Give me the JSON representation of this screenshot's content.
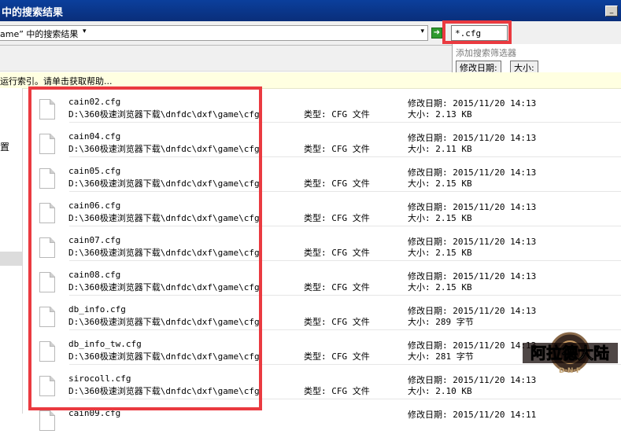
{
  "window": {
    "title": "中的搜索结果",
    "min_glyph": "_",
    "max_glyph": "□"
  },
  "address_bar": {
    "path_text": "ame” 中的搜索结果",
    "dropdown_glyph": "▾",
    "history_glyph": "▾",
    "go_glyph": "➜"
  },
  "search": {
    "value": "*.cfg"
  },
  "filter_popup": {
    "hint": "添加搜索筛选器",
    "date_label": "修改日期:",
    "size_label": "大小:"
  },
  "info_bar": {
    "text": "运行索引。请单击获取帮助..."
  },
  "nav_pane": {
    "glyph": "置"
  },
  "results": [
    {
      "name": "cain02.cfg",
      "path": "D:\\360极速浏览器下载\\dnfdc\\dxf\\game\\cfg",
      "type": "类型: CFG 文件",
      "date": "修改日期: 2015/11/20 14:13",
      "size": "大小: 2.13 KB"
    },
    {
      "name": "cain04.cfg",
      "path": "D:\\360极速浏览器下载\\dnfdc\\dxf\\game\\cfg",
      "type": "类型: CFG 文件",
      "date": "修改日期: 2015/11/20 14:13",
      "size": "大小: 2.11 KB"
    },
    {
      "name": "cain05.cfg",
      "path": "D:\\360极速浏览器下载\\dnfdc\\dxf\\game\\cfg",
      "type": "类型: CFG 文件",
      "date": "修改日期: 2015/11/20 14:13",
      "size": "大小: 2.15 KB"
    },
    {
      "name": "cain06.cfg",
      "path": "D:\\360极速浏览器下载\\dnfdc\\dxf\\game\\cfg",
      "type": "类型: CFG 文件",
      "date": "修改日期: 2015/11/20 14:13",
      "size": "大小: 2.15 KB"
    },
    {
      "name": "cain07.cfg",
      "path": "D:\\360极速浏览器下载\\dnfdc\\dxf\\game\\cfg",
      "type": "类型: CFG 文件",
      "date": "修改日期: 2015/11/20 14:13",
      "size": "大小: 2.15 KB"
    },
    {
      "name": "cain08.cfg",
      "path": "D:\\360极速浏览器下载\\dnfdc\\dxf\\game\\cfg",
      "type": "类型: CFG 文件",
      "date": "修改日期: 2015/11/20 14:13",
      "size": "大小: 2.15 KB"
    },
    {
      "name": "db_info.cfg",
      "path": "D:\\360极速浏览器下载\\dnfdc\\dxf\\game\\cfg",
      "type": "类型: CFG 文件",
      "date": "修改日期: 2015/11/20 14:13",
      "size": "大小: 289 字节"
    },
    {
      "name": "db_info_tw.cfg",
      "path": "D:\\360极速浏览器下载\\dnfdc\\dxf\\game\\cfg",
      "type": "类型: CFG 文件",
      "date": "修改日期: 2015/11/20 14:13",
      "size": "大小: 281 字节"
    },
    {
      "name": "sirocoll.cfg",
      "path": "D:\\360极速浏览器下载\\dnfdc\\dxf\\game\\cfg",
      "type": "类型: CFG 文件",
      "date": "修改日期: 2015/11/20 14:13",
      "size": "大小: 2.10 KB"
    },
    {
      "name": "cain09.cfg",
      "path": "",
      "type": "",
      "date": "修改日期: 2015/11/20 14:11",
      "size": ""
    }
  ],
  "watermark": {
    "text": "阿拉德大陆",
    "sub": "D·N·F"
  },
  "colors": {
    "title_bar": "#0b3f9c",
    "highlight_frame": "#ea3a40",
    "info_bar": "#ffffe1"
  }
}
